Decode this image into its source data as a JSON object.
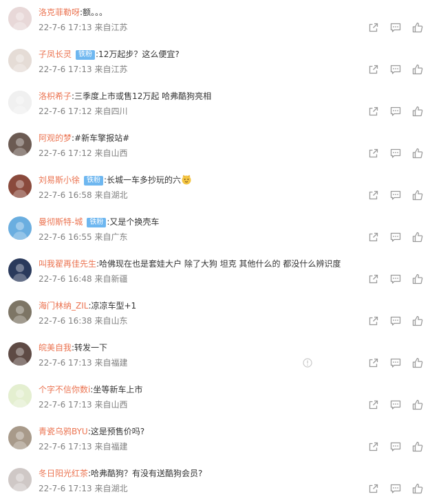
{
  "colors": {
    "username": "#eb7350",
    "badge_bg": "#6eb7f0",
    "meta_text": "#808080",
    "icon": "#9a9a9a"
  },
  "icons": {
    "forward": "forward-icon",
    "comment": "comment-icon",
    "like": "like-icon",
    "report": "report-icon"
  },
  "comments": [
    {
      "username": "洛克菲勒呀",
      "badge": "",
      "text": ":额。。。",
      "time": "22-7-6 17:13",
      "location": "来自江苏",
      "avatar_color": "#e8d8d8",
      "emoji": false,
      "report_icon": false
    },
    {
      "username": "子凤长灵",
      "badge": "铁粉",
      "text": ":12万起步？这么便宜?",
      "time": "22-7-6 17:13",
      "location": "来自江苏",
      "avatar_color": "#e5dcd6",
      "emoji": false,
      "report_icon": false
    },
    {
      "username": "洛枳希子",
      "badge": "",
      "text": ":三季度上市或售12万起 哈弗酷狗亮相",
      "time": "22-7-6 17:12",
      "location": "来自四川",
      "avatar_color": "#f0f0f0",
      "emoji": false,
      "report_icon": false
    },
    {
      "username": "阿观的梦",
      "badge": "",
      "text": ":#新车擎报站#",
      "time": "22-7-6 17:12",
      "location": "来自山西",
      "avatar_color": "#6b5a52",
      "emoji": false,
      "report_icon": false
    },
    {
      "username": "刘易斯小徐",
      "badge": "铁粉",
      "text": ":长城一车多抄玩的六",
      "time": "22-7-6 16:58",
      "location": "来自湖北",
      "avatar_color": "#8a4a3c",
      "emoji": true,
      "report_icon": false
    },
    {
      "username": "曼彻斯特-城",
      "badge": "铁粉",
      "text": ":又是个换壳车",
      "time": "22-7-6 16:55",
      "location": "来自广东",
      "avatar_color": "#6aaee0",
      "emoji": false,
      "report_icon": false
    },
    {
      "username": "叫我翟再佳先生",
      "badge": "",
      "text": ":哈佛现在也是套娃大户  除了大狗 坦克  其他什么的  都没什么辨识度",
      "time": "22-7-6 16:48",
      "location": "来自新疆",
      "avatar_color": "#2a3a5c",
      "emoji": false,
      "report_icon": false
    },
    {
      "username": "海门林纳_ZIL",
      "badge": "",
      "text": ":凉凉车型+1",
      "time": "22-7-6 16:38",
      "location": "来自山东",
      "avatar_color": "#7d7565",
      "emoji": false,
      "report_icon": false
    },
    {
      "username": "皖美自我",
      "badge": "",
      "text": ":转发一下",
      "time": "22-7-6 17:13",
      "location": "来自福建",
      "avatar_color": "#5e4a44",
      "emoji": false,
      "report_icon": true
    },
    {
      "username": "个字不信你数i",
      "badge": "",
      "text": ":坐等新车上市",
      "time": "22-7-6 17:13",
      "location": "来自山西",
      "avatar_color": "#e4efd0",
      "emoji": false,
      "report_icon": false
    },
    {
      "username": "青瓷乌鸦BYU",
      "badge": "",
      "text": ":这是预售价吗?",
      "time": "22-7-6 17:13",
      "location": "来自福建",
      "avatar_color": "#a89a8a",
      "emoji": false,
      "report_icon": false
    },
    {
      "username": "冬日阳光红茶",
      "badge": "",
      "text": ":哈弗酷狗？有没有送酷狗会员?",
      "time": "22-7-6 17:13",
      "location": "来自湖北",
      "avatar_color": "#cfc8c6",
      "emoji": false,
      "report_icon": false
    }
  ]
}
